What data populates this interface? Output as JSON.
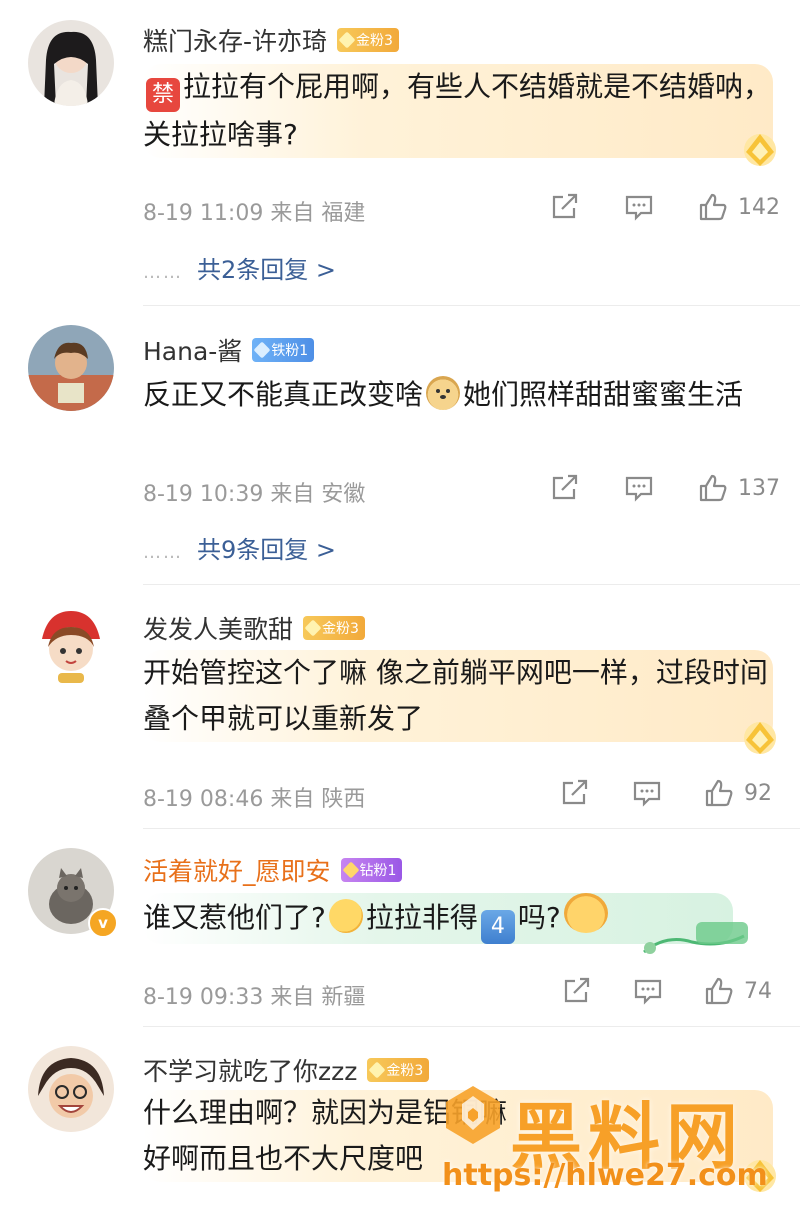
{
  "comments": [
    {
      "username": "糕门永存-许亦琦",
      "badge": "金粉3",
      "body_prefix_emoji": "禁",
      "body": "拉拉有个屁用啊，有些人不结婚就是不结婚呐，关拉拉啥事?",
      "time": "8-19 11:09",
      "source": "来自 福建",
      "likes": "142",
      "replies": "共2条回复 >"
    },
    {
      "username": "Hana-酱",
      "badge": "铁粉1",
      "body_a": "反正又不能真正改变啥",
      "body_b": "她们照样甜甜蜜蜜生活",
      "time": "8-19 10:39",
      "source": "来自 安徽",
      "likes": "137",
      "replies": "共9条回复 >"
    },
    {
      "username": "发发人美歌甜",
      "badge": "金粉3",
      "body": "开始管控这个了嘛 像之前躺平网吧一样，过段时间叠个甲就可以重新发了",
      "time": "8-19 08:46",
      "source": "来自 陕西",
      "likes": "92"
    },
    {
      "username": "活着就好_愿即安",
      "badge": "钻粉1",
      "verified": "v",
      "body_a": "谁又惹他们了?",
      "body_b": "拉拉非得",
      "body_num": "4",
      "body_c": "吗?",
      "time": "8-19 09:33",
      "source": "来自 新疆",
      "likes": "74"
    },
    {
      "username": "不学习就吃了你zzz",
      "badge": "金粉3",
      "body_line1": "什么理由啊？就因为是铝铜嘛",
      "body_line2": "好啊而且也不大尺度吧"
    }
  ],
  "dots": "……",
  "watermark": {
    "title": "黑料网",
    "url": "https://hlwe27.com"
  },
  "colors": {
    "link": "#3b5f96",
    "vip_name": "#e8701a",
    "watermark": "#f79a1a"
  }
}
